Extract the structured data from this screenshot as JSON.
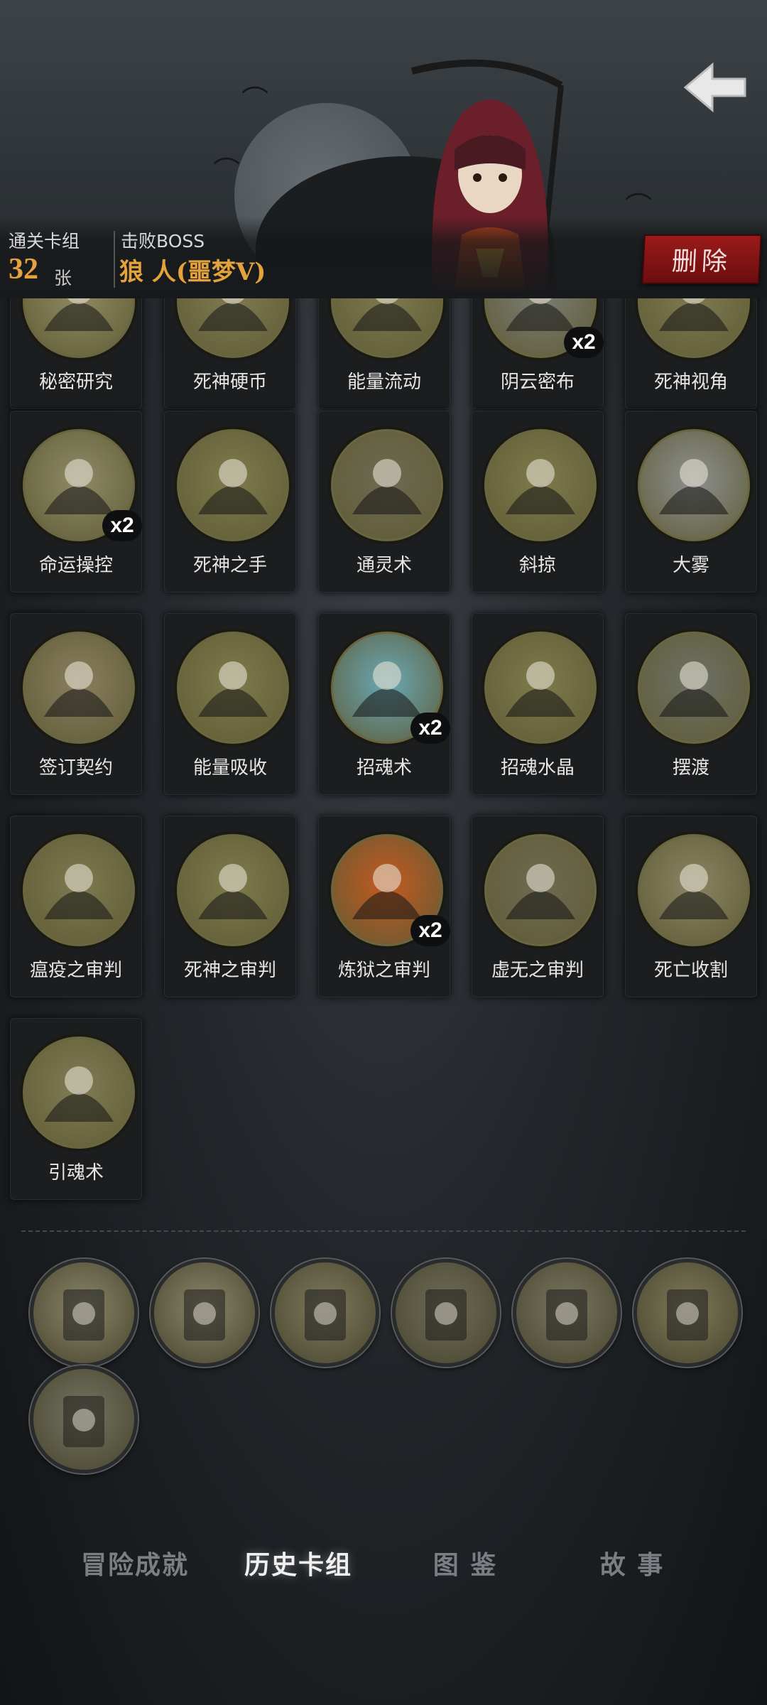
{
  "header": {
    "cleared_deck_label": "通关卡组",
    "card_count": "32",
    "card_unit": "张",
    "boss_label": "击败BOSS",
    "boss_name": "狼 人(噩梦V)",
    "delete_label": "删除"
  },
  "cards": [
    {
      "name": "秘密研究",
      "count": "",
      "color": "#8f8a63"
    },
    {
      "name": "死神硬币",
      "count": "",
      "color": "#7f7b52"
    },
    {
      "name": "能量流动",
      "count": "",
      "color": "#7d7a50"
    },
    {
      "name": "阴云密布",
      "count": "x2",
      "color": "#7c7d74"
    },
    {
      "name": "死神视角",
      "count": "",
      "color": "#7e7b52"
    },
    {
      "name": "命运操控",
      "count": "x2",
      "color": "#8f8b68"
    },
    {
      "name": "死神之手",
      "count": "",
      "color": "#7e7b4c"
    },
    {
      "name": "通灵术",
      "count": "",
      "color": "#6f6a52"
    },
    {
      "name": "斜掠",
      "count": "",
      "color": "#7e7b4c"
    },
    {
      "name": "大雾",
      "count": "",
      "color": "#8e9090"
    },
    {
      "name": "签订契约",
      "count": "",
      "color": "#8a7f60"
    },
    {
      "name": "能量吸收",
      "count": "",
      "color": "#7e7b4c"
    },
    {
      "name": "招魂术",
      "count": "x2",
      "color": "#6aa8b5"
    },
    {
      "name": "招魂水晶",
      "count": "",
      "color": "#7e7b4c"
    },
    {
      "name": "摆渡",
      "count": "",
      "color": "#6f7266"
    },
    {
      "name": "瘟疫之审判",
      "count": "",
      "color": "#7d7a50"
    },
    {
      "name": "死神之审判",
      "count": "",
      "color": "#7e7b4c"
    },
    {
      "name": "炼狱之审判",
      "count": "x2",
      "color": "#c45a20"
    },
    {
      "name": "虚无之审判",
      "count": "",
      "color": "#6f6a52"
    },
    {
      "name": "死亡收割",
      "count": "",
      "color": "#8a8464"
    },
    {
      "name": "引魂术",
      "count": "",
      "color": "#807c55"
    }
  ],
  "relics": [
    {
      "name": "spiral-card-relic",
      "color": "#8a866a"
    },
    {
      "name": "crystal-hand-relic",
      "color": "#8a866a"
    },
    {
      "name": "cuckoo-clock-relic",
      "color": "#7e7a5e"
    },
    {
      "name": "cards-hands-relic",
      "color": "#6f6d5a"
    },
    {
      "name": "vampire-relic",
      "color": "#7a7660"
    },
    {
      "name": "floating-cards-relic",
      "color": "#7f7a5a"
    },
    {
      "name": "bandit-relic",
      "color": "#747462"
    }
  ],
  "tabs": [
    {
      "label": "冒险成就",
      "active": false
    },
    {
      "label": "历史卡组",
      "active": true
    },
    {
      "label": "图 鉴",
      "active": false
    },
    {
      "label": "故 事",
      "active": false
    }
  ]
}
